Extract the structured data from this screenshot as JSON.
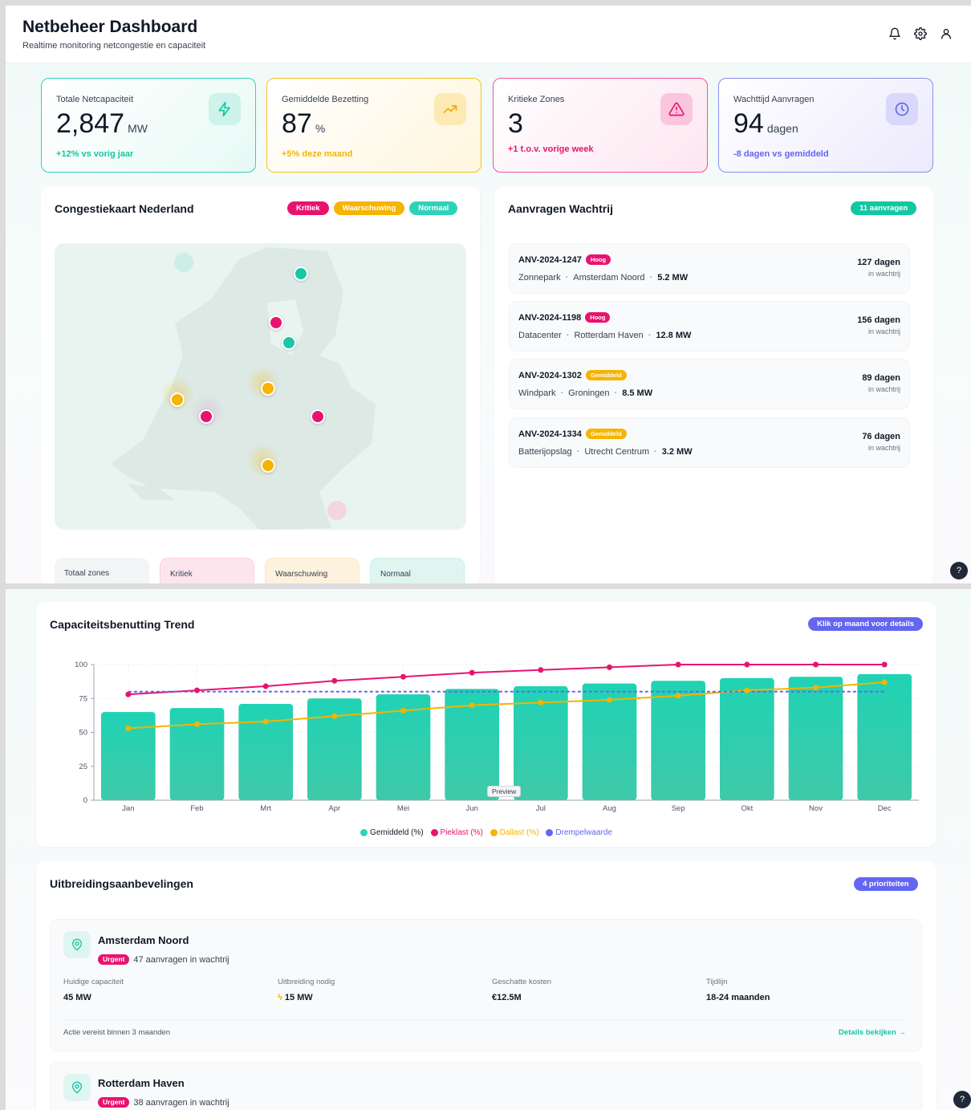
{
  "header": {
    "title": "Netbeheer Dashboard",
    "subtitle": "Realtime monitoring netcongestie en capaciteit"
  },
  "kpis": [
    {
      "label": "Totale Netcapaciteit",
      "value": "2,847",
      "unit": "MW",
      "delta": "+12% vs vorig jaar",
      "color": "#14c7a3",
      "icon": "lightning-icon"
    },
    {
      "label": "Gemiddelde Bezetting",
      "value": "87",
      "unit": "%",
      "delta": "+5% deze maand",
      "color": "#f5b400",
      "icon": "trending-up-icon"
    },
    {
      "label": "Kritieke Zones",
      "value": "3",
      "unit": "",
      "delta": "+1 t.o.v. vorige week",
      "color": "#e8136f",
      "icon": "warning-icon"
    },
    {
      "label": "Wachttijd Aanvragen",
      "value": "94",
      "unit": "dagen",
      "delta": "-8 dagen vs gemiddeld",
      "color": "#6366f1",
      "icon": "clock-icon"
    }
  ],
  "map": {
    "title": "Congestiekaart Nederland",
    "legend": {
      "critical": "Kritiek",
      "warning": "Waarschuwing",
      "normal": "Normaal"
    },
    "zone_tabs": [
      "Totaal zones",
      "Kritiek",
      "Waarschuwing",
      "Normaal"
    ]
  },
  "queue": {
    "title": "Aanvragen Wachtrij",
    "count_badge": "11 aanvragen",
    "in_queue_label": "in wachtrij",
    "items": [
      {
        "id": "ANV-2024-1247",
        "priority": "Hoog",
        "type": "Zonnepark",
        "location": "Amsterdam Noord",
        "mw": "5.2 MW",
        "days": "127 dagen"
      },
      {
        "id": "ANV-2024-1198",
        "priority": "Hoog",
        "type": "Datacenter",
        "location": "Rotterdam Haven",
        "mw": "12.8 MW",
        "days": "156 dagen"
      },
      {
        "id": "ANV-2024-1302",
        "priority": "Gemiddeld",
        "type": "Windpark",
        "location": "Groningen",
        "mw": "8.5 MW",
        "days": "89 dagen"
      },
      {
        "id": "ANV-2024-1334",
        "priority": "Gemiddeld",
        "type": "Batterijopslag",
        "location": "Utrecht Centrum",
        "mw": "3.2 MW",
        "days": "76 dagen"
      }
    ]
  },
  "trend": {
    "title": "Capaciteitsbenutting Trend",
    "badge": "Klik op maand voor details",
    "tooltip": "Preview"
  },
  "chart_data": {
    "type": "bar",
    "categories": [
      "Jan",
      "Feb",
      "Mrt",
      "Apr",
      "Mei",
      "Jun",
      "Jul",
      "Aug",
      "Sep",
      "Okt",
      "Nov",
      "Dec"
    ],
    "ylim": [
      0,
      100
    ],
    "yticks": [
      0,
      25,
      50,
      75,
      100
    ],
    "series": [
      {
        "name": "Gemiddeld (%)",
        "kind": "bar",
        "color": "#2ed3b7",
        "values": [
          65,
          68,
          71,
          75,
          78,
          82,
          84,
          86,
          88,
          90,
          91,
          93
        ]
      },
      {
        "name": "Pieklast (%)",
        "kind": "line",
        "color": "#e8136f",
        "values": [
          78,
          81,
          84,
          88,
          91,
          94,
          96,
          98,
          100,
          100,
          100,
          100
        ]
      },
      {
        "name": "Dallast (%)",
        "kind": "line",
        "color": "#f5b400",
        "values": [
          53,
          56,
          58,
          62,
          66,
          70,
          72,
          74,
          77,
          81,
          83,
          87
        ]
      },
      {
        "name": "Drempelwaarde",
        "kind": "dashed",
        "color": "#6366f1",
        "values": [
          80,
          80,
          80,
          80,
          80,
          80,
          80,
          80,
          80,
          80,
          80,
          80
        ]
      }
    ],
    "legend_position": "bottom",
    "grid": true
  },
  "recommendations": {
    "title": "Uitbreidingsaanbevelingen",
    "badge": "4 prioriteiten",
    "labels": {
      "current": "Huidige capaciteit",
      "expansion": "Uitbreiding nodig",
      "cost": "Geschatte kosten",
      "timeline": "Tijdlijn",
      "details_link": "Details bekijken"
    },
    "items": [
      {
        "name": "Amsterdam Noord",
        "urgency": "Urgent",
        "requests": "47 aanvragen in wachtrij",
        "current": "45 MW",
        "expansion": "15 MW",
        "cost": "€12.5M",
        "timeline": "18-24 maanden",
        "action": "Actie vereist binnen 3 maanden"
      },
      {
        "name": "Rotterdam Haven",
        "urgency": "Urgent",
        "requests": "38 aanvragen in wachtrij"
      }
    ]
  },
  "help": "?"
}
